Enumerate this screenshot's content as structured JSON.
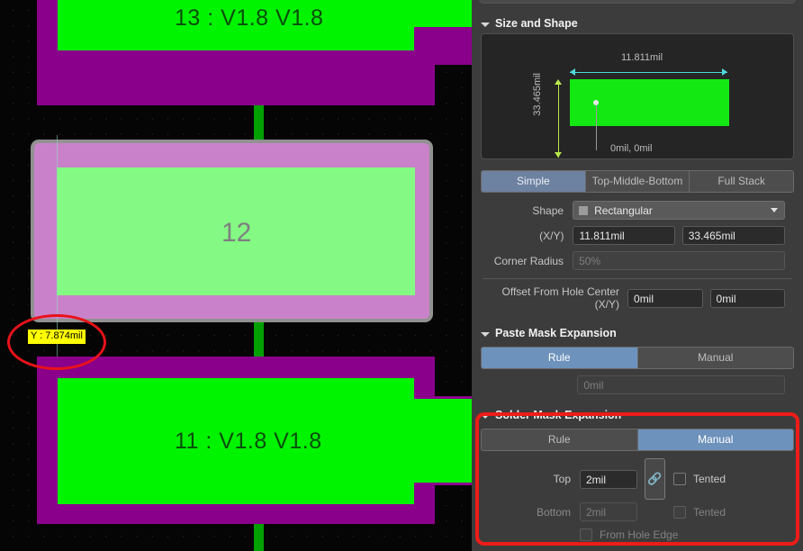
{
  "canvas": {
    "pad_top": {
      "label": "13 : V1.8    V1.8",
      "designator": "13",
      "net": "V1.8"
    },
    "pad_selected": {
      "label": "12",
      "designator": "12"
    },
    "pad_bottom": {
      "label": "11 : V1.8   V1.8",
      "designator": "11",
      "net": "V1.8"
    },
    "tooltip": "Y : 7.874mil",
    "colors": {
      "pad_copper": "#00F400",
      "pad_mask": "#8B008B",
      "selected_mask": "#C982C9",
      "selected_copper": "#84F984",
      "selection_outline": "#919191",
      "track": "#00A000",
      "tooltip_bg": "#FFFF00",
      "annotation": "#E8121A"
    }
  },
  "panel": {
    "size_and_shape": {
      "title": "Size and Shape",
      "preview": {
        "width_label": "11.811mil",
        "height_label": "33.465mil",
        "origin_label": "0mil, 0mil",
        "shape_color": "#13E813",
        "width_arrow_color": "#4FD8D8",
        "height_arrow_color": "#B9E84A"
      },
      "mode_tabs": [
        {
          "label": "Simple",
          "selected": true
        },
        {
          "label": "Top-Middle-Bottom",
          "selected": false
        },
        {
          "label": "Full Stack",
          "selected": false
        }
      ],
      "shape_label": "Shape",
      "shape_value": "Rectangular",
      "xy_label": "(X/Y)",
      "size_x": "11.811mil",
      "size_y": "33.465mil",
      "corner_radius_label": "Corner Radius",
      "corner_radius_placeholder": "50%",
      "offset_label": "Offset From Hole Center (X/Y)",
      "offset_x": "0mil",
      "offset_y": "0mil"
    },
    "paste_mask": {
      "title": "Paste Mask Expansion",
      "tabs": [
        {
          "label": "Rule",
          "selected": true
        },
        {
          "label": "Manual",
          "selected": false
        }
      ],
      "value": "0mil"
    },
    "solder_mask": {
      "title": "Solder Mask Expansion",
      "tabs": [
        {
          "label": "Rule",
          "selected": false
        },
        {
          "label": "Manual",
          "selected": true
        }
      ],
      "top_label": "Top",
      "top_value": "2mil",
      "bottom_label": "Bottom",
      "bottom_value": "2mil",
      "link_icon": "link-chain-icon",
      "tented_top_label": "Tented",
      "tented_bottom_label": "Tented",
      "from_hole_edge_label": "From Hole Edge",
      "highlight_color": "#EE1C18"
    }
  }
}
